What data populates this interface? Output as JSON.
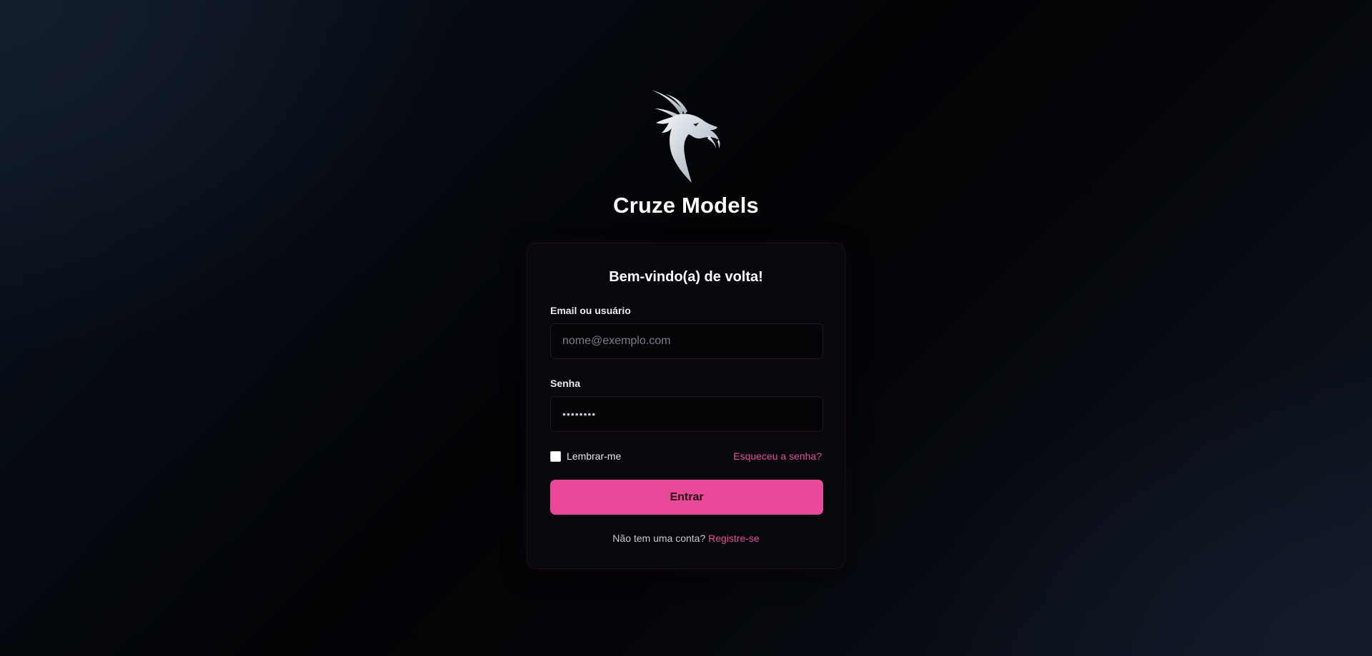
{
  "brand": {
    "logo_icon": "dragon-head-icon",
    "name": "Cruze Models"
  },
  "login": {
    "title": "Bem-vindo(a) de volta!",
    "email_label": "Email ou usuário",
    "email_placeholder": "nome@exemplo.com",
    "email_value": "",
    "password_label": "Senha",
    "password_value": "••••••••",
    "remember_label": "Lembrar-me",
    "remember_checked": false,
    "forgot_link": "Esqueceu a senha?",
    "submit_label": "Entrar",
    "signup_prompt": "Não tem uma conta?",
    "signup_link": "Registre-se"
  },
  "colors": {
    "accent": "#ec4899",
    "card_bg": "#07080c",
    "background": "#020305"
  }
}
